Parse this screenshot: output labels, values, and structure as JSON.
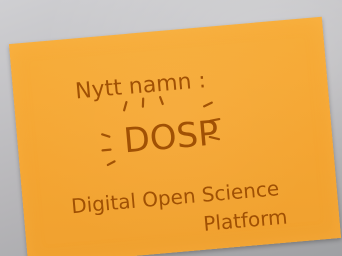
{
  "note": {
    "header": "Nytt namn :",
    "acronym": "DOSP",
    "expansion_line1": "Digital Open Science",
    "expansion_line2": "Platform"
  },
  "colors": {
    "note": "#f4a532",
    "ink": "#9a4a00",
    "wall": "#b9b8bb"
  }
}
